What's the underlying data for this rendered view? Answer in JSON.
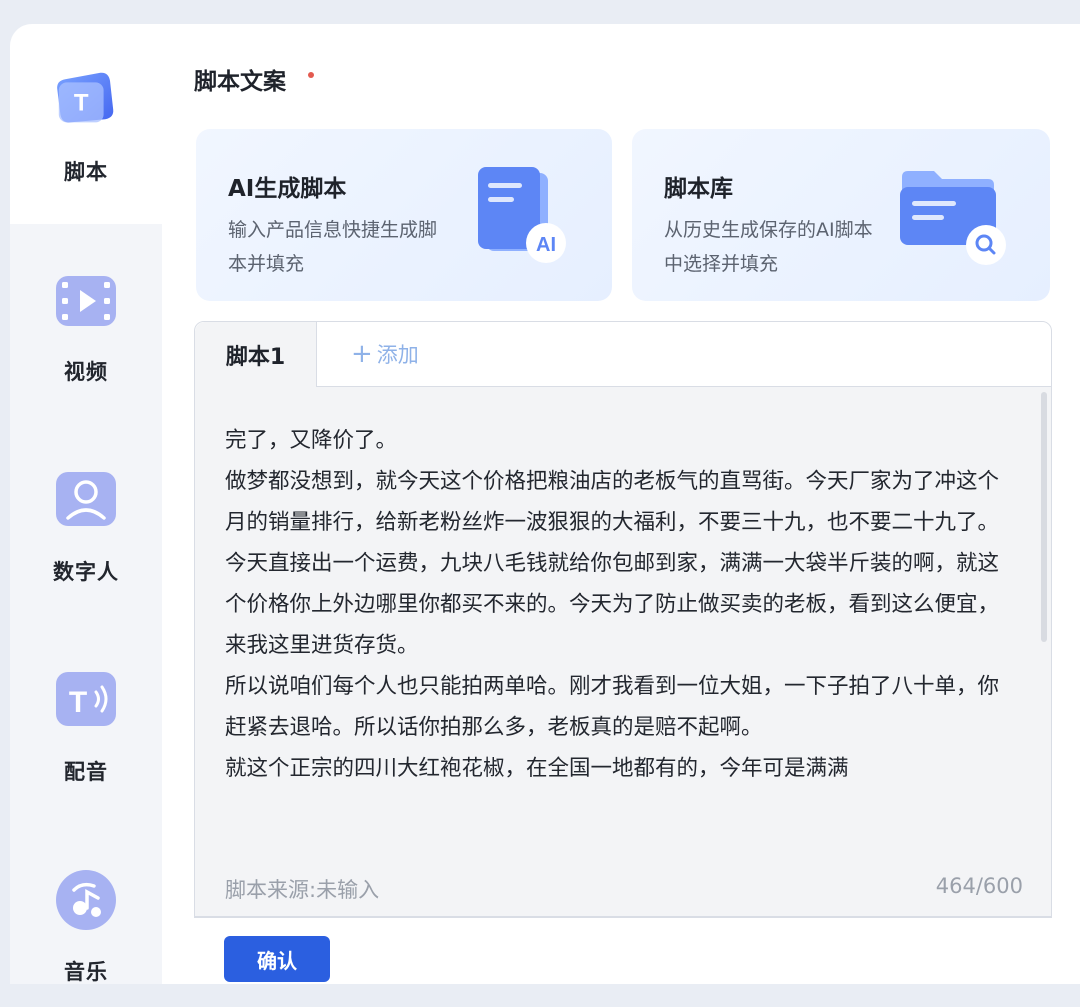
{
  "sidebar": {
    "items": [
      {
        "label": "脚本",
        "icon": "script-icon"
      },
      {
        "label": "视频",
        "icon": "video-icon"
      },
      {
        "label": "数字人",
        "icon": "digital-human-icon"
      },
      {
        "label": "配音",
        "icon": "voiceover-icon"
      },
      {
        "label": "音乐",
        "icon": "music-icon"
      }
    ],
    "active_index": 0
  },
  "section": {
    "title": "脚本文案"
  },
  "cards": [
    {
      "title": "AI生成脚本",
      "description": "输入产品信息快捷生成脚本并填充",
      "icon": "ai-document-icon",
      "badge": "AI"
    },
    {
      "title": "脚本库",
      "description": "从历史生成保存的AI脚本中选择并填充",
      "icon": "folder-search-icon"
    }
  ],
  "editor": {
    "tabs": [
      {
        "label": "脚本1"
      }
    ],
    "add_tab_label": "添加",
    "paragraphs": [
      "完了，又降价了。",
      "做梦都没想到，就今天这个价格把粮油店的老板气的直骂街。今天厂家为了冲这个月的销量排行，给新老粉丝炸一波狠狠的大福利，不要三十九，也不要二十九了。",
      "今天直接出一个运费，九块八毛钱就给你包邮到家，满满一大袋半斤装的啊，就这个价格你上外边哪里你都买不来的。今天为了防止做买卖的老板，看到这么便宜，来我这里进货存货。",
      "所以说咱们每个人也只能拍两单哈。刚才我看到一位大姐，一下子拍了八十单，你赶紧去退哈。所以话你拍那么多，老板真的是赔不起啊。",
      "就这个正宗的四川大红袍花椒，在全国一地都有的，今年可是满满"
    ],
    "source_label": "脚本来源:未输入",
    "char_count": "464/600"
  },
  "confirm_label": "确认",
  "colors": {
    "primary": "#2b5fe0",
    "required_dot": "#e35a4f",
    "add_tab": "#8fb2e8"
  }
}
